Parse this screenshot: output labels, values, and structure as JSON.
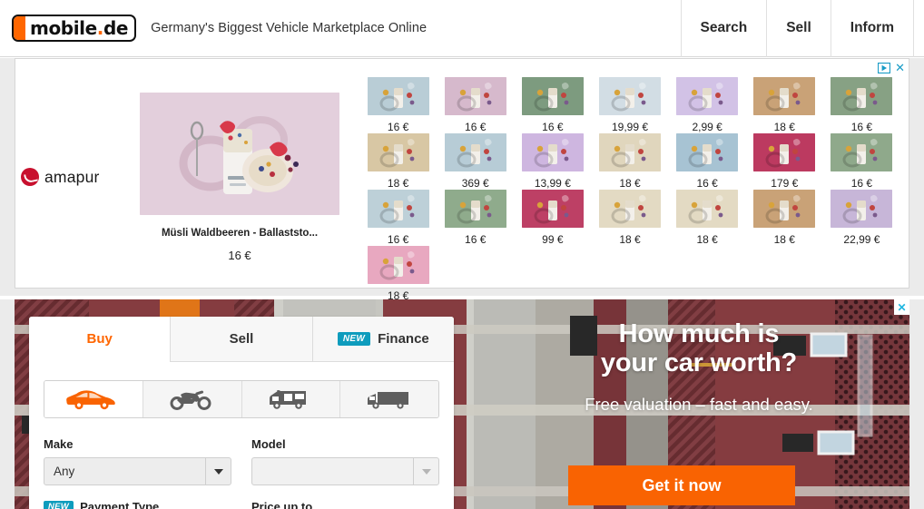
{
  "header": {
    "logo": {
      "name": "mobile",
      "tld": "de",
      "dot": "."
    },
    "tagline": "Germany's Biggest Vehicle Marketplace Online",
    "nav": [
      {
        "label": "Search",
        "name": "nav-search"
      },
      {
        "label": "Sell",
        "name": "nav-sell"
      },
      {
        "label": "Inform",
        "name": "nav-inform"
      }
    ]
  },
  "top_ad": {
    "adchoices_label": "AdChoices",
    "close_label": "✕",
    "brand": "amapur",
    "hero_product": {
      "title": "Müsli Waldbeeren - Ballaststo...",
      "price": "16 €"
    },
    "grid": [
      {
        "price": "16 €",
        "bg": "#b9cdd6"
      },
      {
        "price": "16 €",
        "bg": "#d6b9cc"
      },
      {
        "price": "16 €",
        "bg": "#7d9b7f"
      },
      {
        "price": "19,99 €",
        "bg": "#d2dde4"
      },
      {
        "price": "2,99 €",
        "bg": "#d2c2e6"
      },
      {
        "price": "18 €",
        "bg": "#c9a277"
      },
      {
        "price": "16 €",
        "bg": "#87a184"
      },
      {
        "price": "18 €",
        "bg": "#d8c7a4"
      },
      {
        "price": "369 €",
        "bg": "#b7ccd6"
      },
      {
        "price": "13,99 €",
        "bg": "#ceb6e0"
      },
      {
        "price": "18 €",
        "bg": "#e0d6bd"
      },
      {
        "price": "16 €",
        "bg": "#a7c3d3"
      },
      {
        "price": "179 €",
        "bg": "#bc3a60"
      },
      {
        "price": "16 €",
        "bg": "#8fa98b"
      },
      {
        "price": "16 €",
        "bg": "#bdd0d8"
      },
      {
        "price": "16 €",
        "bg": "#8fab8c"
      },
      {
        "price": "99 €",
        "bg": "#bd4065"
      },
      {
        "price": "18 €",
        "bg": "#e3dac3"
      },
      {
        "price": "18 €",
        "bg": "#e3dac3"
      },
      {
        "price": "18 €",
        "bg": "#c9a277"
      },
      {
        "price": "22,99 €",
        "bg": "#c7b6d8"
      },
      {
        "price": "18 €",
        "bg": "#e8a8c0"
      }
    ]
  },
  "hero_ad": {
    "headline_line1": "How much is",
    "headline_line2": "your car worth?",
    "subline": "Free valuation – fast and easy.",
    "cta": "Get it now",
    "close_label": "✕",
    "cta_color": "#f96302"
  },
  "search_widget": {
    "tabs": [
      {
        "label": "Buy",
        "name": "tab-buy",
        "active": true,
        "badge": ""
      },
      {
        "label": "Sell",
        "name": "tab-sell",
        "active": false,
        "badge": ""
      },
      {
        "label": "Finance",
        "name": "tab-finance",
        "active": false,
        "badge": "NEW"
      }
    ],
    "vehicle_types": [
      {
        "name": "car-icon",
        "selected": true
      },
      {
        "name": "motorcycle-icon",
        "selected": false
      },
      {
        "name": "motorhome-icon",
        "selected": false
      },
      {
        "name": "van-icon",
        "selected": false
      }
    ],
    "make": {
      "label": "Make",
      "value": "Any"
    },
    "model": {
      "label": "Model",
      "value": ""
    },
    "payment_type": {
      "label": "Payment Type",
      "badge": "NEW"
    },
    "price_up_to": {
      "label": "Price up to"
    },
    "accent_color": "#ff6600"
  }
}
